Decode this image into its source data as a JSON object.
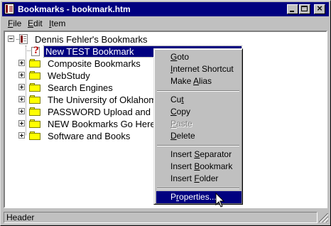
{
  "window": {
    "title": "Bookmarks - bookmark.htm",
    "controls": {
      "minimize": "_",
      "maximize": "□",
      "close": "×"
    }
  },
  "menubar": [
    {
      "label": "File",
      "accel": "F",
      "rest": "ile"
    },
    {
      "label": "Edit",
      "accel": "E",
      "rest": "dit"
    },
    {
      "label": "Item",
      "accel": "I",
      "rest": "tem"
    }
  ],
  "tree": {
    "root": {
      "label": "Dennis Fehler's Bookmarks",
      "icon": "bookmark-file-icon",
      "expanded": true
    },
    "items": [
      {
        "label": "New TEST Bookmark",
        "icon": "bookmark-icon",
        "selected": true
      },
      {
        "label": "Composite Bookmarks",
        "icon": "folder-icon"
      },
      {
        "label": "WebStudy",
        "icon": "folder-icon"
      },
      {
        "label": "Search Engines",
        "icon": "folder-icon"
      },
      {
        "label": "The University of Oklahoma",
        "icon": "folder-icon"
      },
      {
        "label": "PASSWORD  Upload and Download Sites",
        "icon": "folder-icon"
      },
      {
        "label": "NEW Bookmarks Go Here",
        "icon": "folder-icon"
      },
      {
        "label": "Software and Books",
        "icon": "folder-icon"
      }
    ]
  },
  "context_menu": {
    "items": [
      {
        "pre": "",
        "accel": "G",
        "post": "oto"
      },
      {
        "pre": "",
        "accel": "I",
        "post": "nternet Shortcut"
      },
      {
        "pre": "Make ",
        "accel": "A",
        "post": "lias"
      },
      {
        "pre": "Cu",
        "accel": "t",
        "post": ""
      },
      {
        "pre": "",
        "accel": "C",
        "post": "opy"
      },
      {
        "pre": "",
        "accel": "P",
        "post": "aste",
        "disabled": true
      },
      {
        "pre": "",
        "accel": "D",
        "post": "elete"
      },
      {
        "pre": "Insert ",
        "accel": "S",
        "post": "eparator"
      },
      {
        "pre": "Insert ",
        "accel": "B",
        "post": "ookmark"
      },
      {
        "pre": "Insert ",
        "accel": "F",
        "post": "older"
      },
      {
        "pre": "P",
        "accel": "r",
        "post": "operties...",
        "highlighted": true
      }
    ]
  },
  "statusbar": {
    "text": "Header"
  },
  "colors": {
    "title_bar": "#000080",
    "selection": "#000080",
    "face": "#c0c0c0",
    "folder": "#ffff00"
  }
}
